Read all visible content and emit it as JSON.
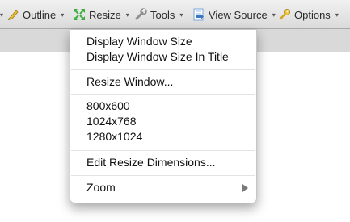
{
  "toolbar": {
    "items": [
      {
        "label": "Outline",
        "icon": "pencil-icon"
      },
      {
        "label": "Resize",
        "icon": "resize-arrows-icon"
      },
      {
        "label": "Tools",
        "icon": "wrench-icon"
      },
      {
        "label": "View Source",
        "icon": "document-arrow-icon"
      },
      {
        "label": "Options",
        "icon": "key-icon"
      }
    ]
  },
  "resize_menu": {
    "display_window_size": "Display Window Size",
    "display_window_size_in_title": "Display Window Size In Title",
    "resize_window": "Resize Window...",
    "sizes": [
      "800x600",
      "1024x768",
      "1280x1024"
    ],
    "edit_resize_dimensions": "Edit Resize Dimensions...",
    "zoom": "Zoom"
  },
  "colors": {
    "toolbar_bg": "#e4e4e4",
    "menu_bg": "#ffffff",
    "resize_icon_green": "#3fae3f"
  }
}
